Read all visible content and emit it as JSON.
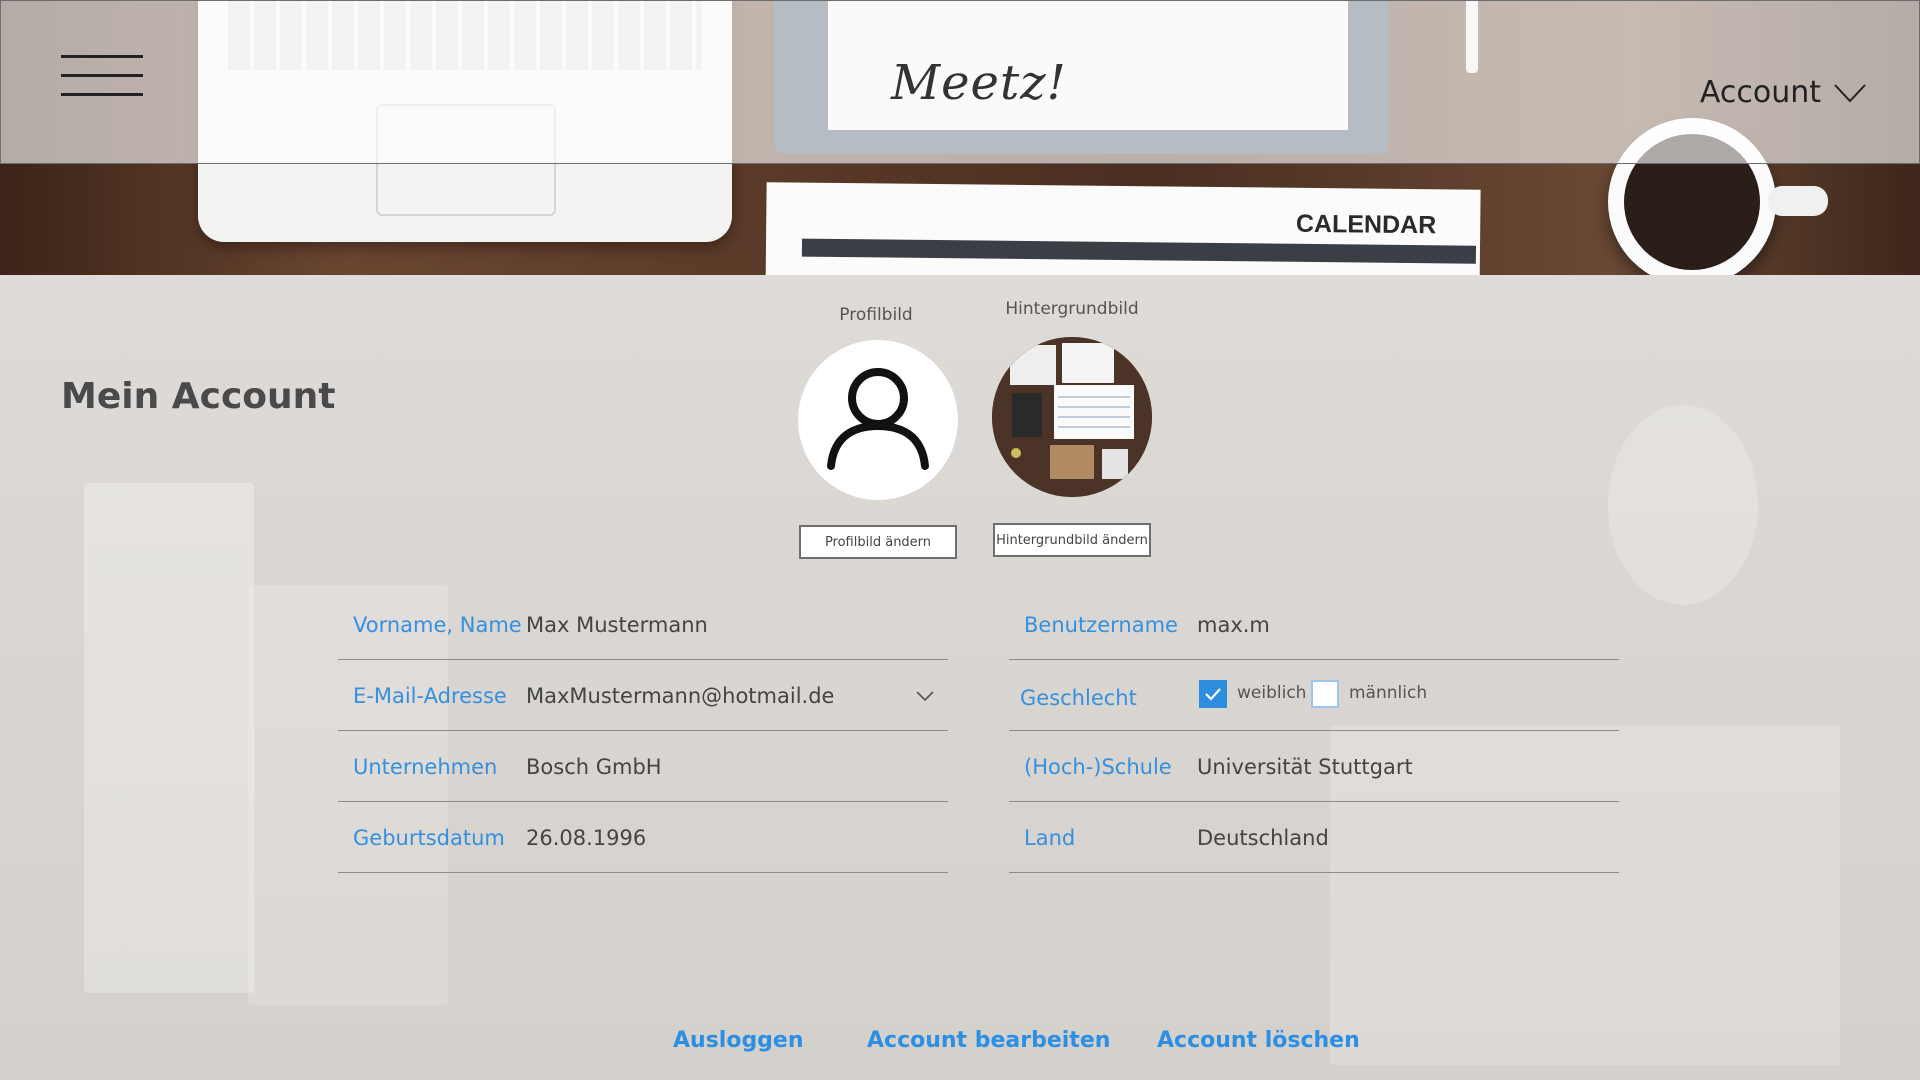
{
  "header": {
    "logo": "Meetz!",
    "account_label": "Account"
  },
  "hero": {
    "calendar_text": "CALENDAR"
  },
  "page": {
    "title": "Mein Account"
  },
  "images": {
    "profile_label": "Profilbild",
    "profile_button": "Profilbild ändern",
    "background_label": "Hintergrundbild",
    "background_button": "Hintergrundbild ändern"
  },
  "form": {
    "left": [
      {
        "label": "Vorname, Name",
        "value": "Max Mustermann"
      },
      {
        "label": "E-Mail-Adresse",
        "value": "MaxMustermann@hotmail.de"
      },
      {
        "label": "Unternehmen",
        "value": "Bosch GmbH"
      },
      {
        "label": "Geburtsdatum",
        "value": "26.08.1996"
      }
    ],
    "right": [
      {
        "label": "Benutzername",
        "value": "max.m"
      },
      {
        "label": "Geschlecht",
        "value": ""
      },
      {
        "label": "(Hoch-)Schule",
        "value": "Universität Stuttgart"
      },
      {
        "label": "Land",
        "value": "Deutschland"
      }
    ],
    "gender_options": [
      {
        "label": "weiblich",
        "checked": true
      },
      {
        "label": "männlich",
        "checked": false
      }
    ]
  },
  "actions": {
    "logout": "Ausloggen",
    "edit": "Account bearbeiten",
    "delete": "Account löschen"
  },
  "colors": {
    "accent": "#2b8fe4",
    "label": "#3590e0",
    "checkbox_checked": "#2d8ddf"
  }
}
